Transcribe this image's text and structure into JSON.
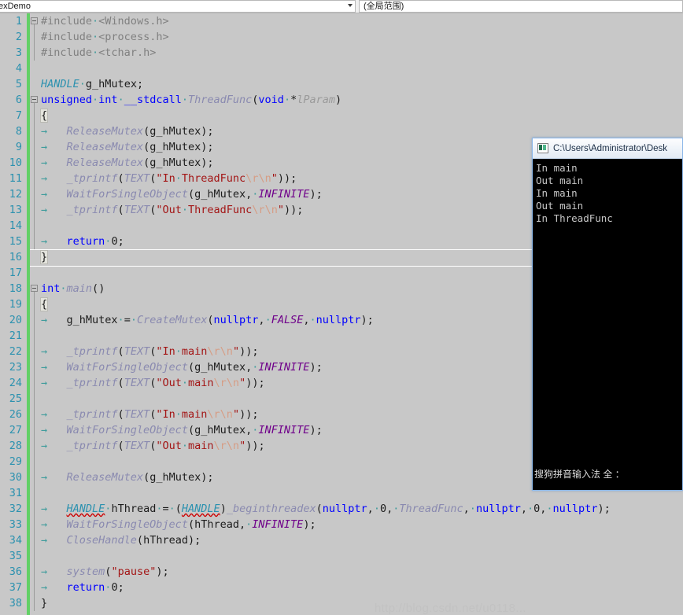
{
  "topbar": {
    "scope_combo_value": "exDemo",
    "member_combo_value": "(全局范围)",
    "dropdown_icon": "chevron-down-icon"
  },
  "editor": {
    "language": "cpp",
    "current_line": 16,
    "tab_glyph": "→",
    "space_glyph": "·",
    "lines": [
      {
        "n": 1,
        "fold": "open"
      },
      {
        "n": 2
      },
      {
        "n": 3
      },
      {
        "n": 4
      },
      {
        "n": 5
      },
      {
        "n": 6,
        "fold": "open"
      },
      {
        "n": 7
      },
      {
        "n": 8
      },
      {
        "n": 9
      },
      {
        "n": 10
      },
      {
        "n": 11
      },
      {
        "n": 12
      },
      {
        "n": 13
      },
      {
        "n": 14
      },
      {
        "n": 15
      },
      {
        "n": 16
      },
      {
        "n": 17
      },
      {
        "n": 18,
        "fold": "open"
      },
      {
        "n": 19
      },
      {
        "n": 20
      },
      {
        "n": 21
      },
      {
        "n": 22
      },
      {
        "n": 23
      },
      {
        "n": 24
      },
      {
        "n": 25
      },
      {
        "n": 26
      },
      {
        "n": 27
      },
      {
        "n": 28
      },
      {
        "n": 29
      },
      {
        "n": 30
      },
      {
        "n": 31
      },
      {
        "n": 32
      },
      {
        "n": 33
      },
      {
        "n": 34
      },
      {
        "n": 35
      },
      {
        "n": 36
      },
      {
        "n": 37
      },
      {
        "n": 38
      }
    ],
    "source_text": [
      "#include <Windows.h>",
      "#include <process.h>",
      "#include <tchar.h>",
      "",
      "HANDLE g_hMutex;",
      "unsigned int __stdcall ThreadFunc(void *lParam)",
      "{",
      "\tReleaseMutex(g_hMutex);",
      "\tReleaseMutex(g_hMutex);",
      "\tReleaseMutex(g_hMutex);",
      "\t_tprintf(TEXT(\"In ThreadFunc\\r\\n\"));",
      "\tWaitForSingleObject(g_hMutex, INFINITE);",
      "\t_tprintf(TEXT(\"Out ThreadFunc\\r\\n\"));",
      "",
      "\treturn 0;",
      "}",
      "",
      "int main()",
      "{",
      "\tg_hMutex = CreateMutex(nullptr, FALSE, nullptr);",
      "",
      "\t_tprintf(TEXT(\"In main\\r\\n\"));",
      "\tWaitForSingleObject(g_hMutex, INFINITE);",
      "\t_tprintf(TEXT(\"Out main\\r\\n\"));",
      "",
      "\t_tprintf(TEXT(\"In main\\r\\n\"));",
      "\tWaitForSingleObject(g_hMutex, INFINITE);",
      "\t_tprintf(TEXT(\"Out main\\r\\n\"));",
      "",
      "\tReleaseMutex(g_hMutex);",
      "",
      "\tHANDLE hThread = (HANDLE)_beginthreadex(nullptr, 0, ThreadFunc, nullptr, 0, nullptr);",
      "\tWaitForSingleObject(hThread, INFINITE);",
      "\tCloseHandle(hThread);",
      "",
      "\tsystem(\"pause\");",
      "\treturn 0;",
      "}"
    ]
  },
  "console": {
    "icon": "console-window-icon",
    "title": "C:\\Users\\Administrator\\Desk",
    "output_lines": [
      "In main",
      "Out main",
      "In main",
      "Out main",
      "In ThreadFunc"
    ],
    "ime_status": "搜狗拼音输入法 全 ："
  },
  "watermark": {
    "text": "http://blog.csdn.net/u0118..."
  },
  "colors": {
    "editor_background": "#c8c8c8",
    "change_bar": "#62d066",
    "line_number": "#2b91af",
    "keyword": "#0000ff",
    "string": "#a31515",
    "escape": "#d69d85",
    "type": "#2b91af",
    "macro": "#6f008a",
    "function": "#8a8ab0",
    "whitespace_marker": "#3f9c9c",
    "console_background": "#000000",
    "console_text": "#c8c8c8"
  }
}
